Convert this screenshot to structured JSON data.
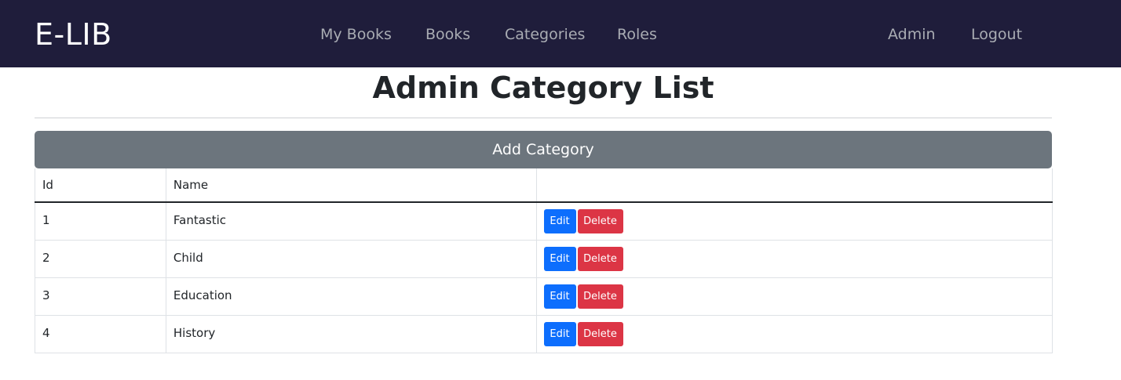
{
  "navbar": {
    "brand": "E-LIB",
    "links": [
      "My Books",
      "Books",
      "Categories",
      "Roles"
    ],
    "right_links": [
      "Admin",
      "Logout"
    ]
  },
  "main": {
    "title": "Admin Category List",
    "add_button_label": "Add Category",
    "table": {
      "columns": [
        "Id",
        "Name",
        ""
      ],
      "rows": [
        {
          "id": "1",
          "name": "Fantastic"
        },
        {
          "id": "2",
          "name": "Child"
        },
        {
          "id": "3",
          "name": "Education"
        },
        {
          "id": "4",
          "name": "History"
        }
      ],
      "edit_label": "Edit",
      "delete_label": "Delete"
    }
  },
  "colors": {
    "navbar_bg": "#1f1d3b",
    "secondary_button": "#6c757d",
    "edit_button": "#0d6efd",
    "delete_button": "#dc3545"
  }
}
